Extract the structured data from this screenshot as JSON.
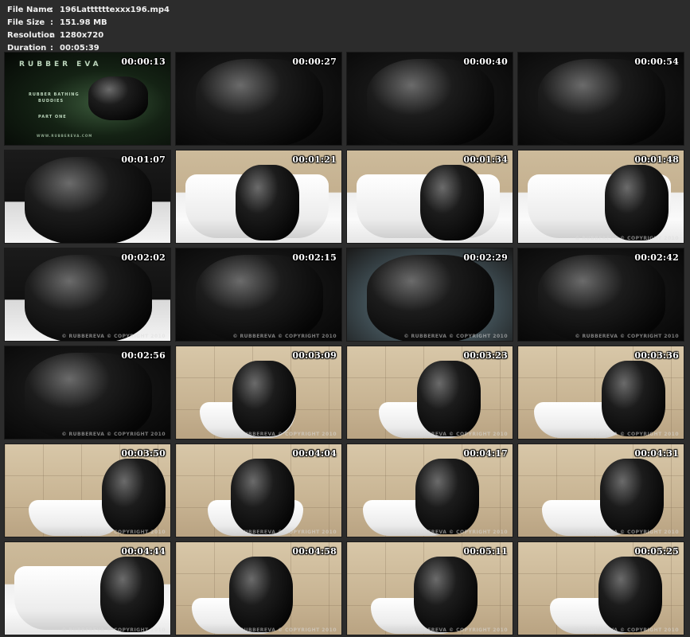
{
  "header": {
    "file_name_label": "File Name",
    "file_name": "196Lattttttexxx196.mp4",
    "file_size_label": "File Size",
    "file_size": "151.98 MB",
    "resolution_label": "Resolution",
    "resolution": "1280x720",
    "duration_label": "Duration",
    "duration": "00:05:39",
    "separator": ":"
  },
  "title_card": {
    "brand": "RUBBER EVA",
    "subtitle_line1": "RUBBER BATHING",
    "subtitle_line2": "BUDDIES",
    "part": "PART ONE",
    "site": "WWW.RUBBEREVA.COM"
  },
  "watermark": "© RUBBEREVA © COPYRIGHT 2010",
  "thumbnails": [
    {
      "time": "00:00:13",
      "scene": "title"
    },
    {
      "time": "00:00:27",
      "scene": "dark"
    },
    {
      "time": "00:00:40",
      "scene": "dark"
    },
    {
      "time": "00:00:54",
      "scene": "dark"
    },
    {
      "time": "00:01:07",
      "scene": "foam"
    },
    {
      "time": "00:01:21",
      "scene": "bath"
    },
    {
      "time": "00:01:34",
      "scene": "bath"
    },
    {
      "time": "00:01:48",
      "scene": "bath"
    },
    {
      "time": "00:02:02",
      "scene": "foam"
    },
    {
      "time": "00:02:15",
      "scene": "dark"
    },
    {
      "time": "00:02:29",
      "scene": "water"
    },
    {
      "time": "00:02:42",
      "scene": "dark"
    },
    {
      "time": "00:02:56",
      "scene": "dark"
    },
    {
      "time": "00:03:09",
      "scene": "tile"
    },
    {
      "time": "00:03:23",
      "scene": "tile"
    },
    {
      "time": "00:03:36",
      "scene": "tile"
    },
    {
      "time": "00:03:50",
      "scene": "tile"
    },
    {
      "time": "00:04:04",
      "scene": "tile"
    },
    {
      "time": "00:04:17",
      "scene": "tile"
    },
    {
      "time": "00:04:31",
      "scene": "tile"
    },
    {
      "time": "00:04:44",
      "scene": "bath"
    },
    {
      "time": "00:04:58",
      "scene": "tile"
    },
    {
      "time": "00:05:11",
      "scene": "tile"
    },
    {
      "time": "00:05:25",
      "scene": "tile"
    }
  ]
}
